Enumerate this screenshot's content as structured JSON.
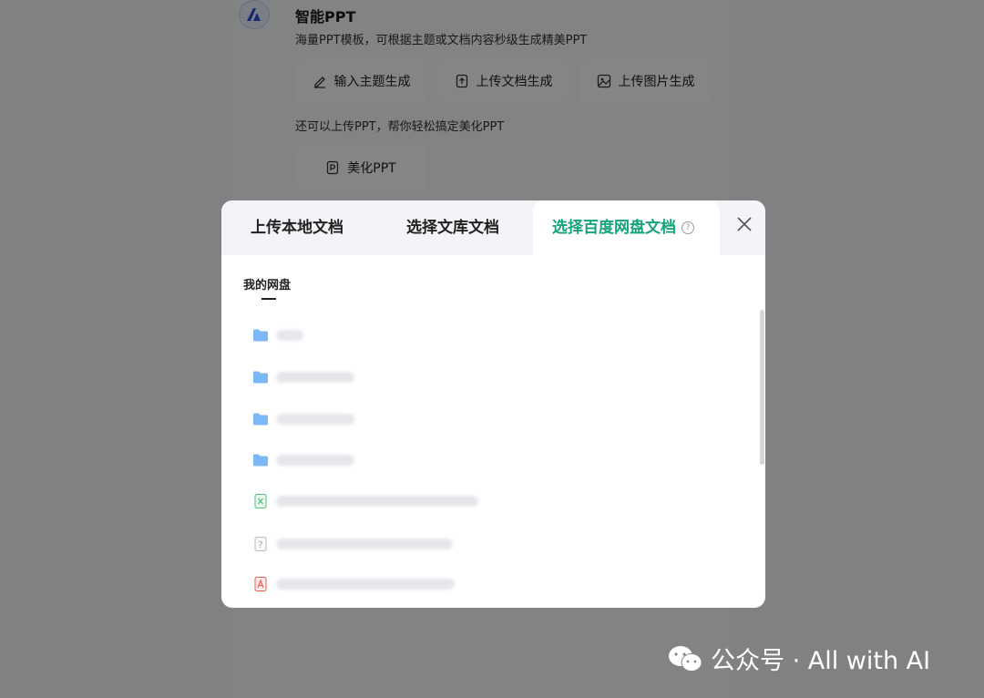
{
  "page": {
    "title": "智能PPT",
    "description": "海量PPT模板，可根据主题或文档内容秒级生成精美PPT",
    "buttons": [
      {
        "label": "输入主题生成"
      },
      {
        "label": "上传文档生成"
      },
      {
        "label": "上传图片生成"
      }
    ],
    "hint": "还可以上传PPT，帮你轻松搞定美化PPT",
    "beautify_label": "美化PPT"
  },
  "modal": {
    "tabs": [
      {
        "label": "上传本地文档"
      },
      {
        "label": "选择文库文档"
      },
      {
        "label": "选择百度网盘文档"
      }
    ],
    "active_tab": 2,
    "section": "我的网盘",
    "files": [
      {
        "type": "folder"
      },
      {
        "type": "folder"
      },
      {
        "type": "folder"
      },
      {
        "type": "folder"
      },
      {
        "type": "excel"
      },
      {
        "type": "unknown"
      },
      {
        "type": "pdf"
      }
    ]
  },
  "watermark": {
    "text": "公众号 · All with AI"
  },
  "colors": {
    "accent": "#16a37b",
    "folder": "#7db8f6",
    "excel": "#4fbf7f",
    "pdf": "#f05a4f"
  }
}
